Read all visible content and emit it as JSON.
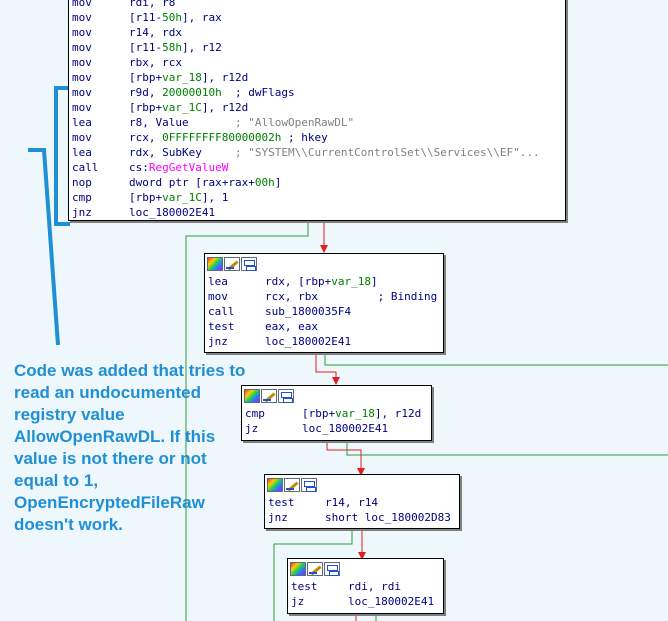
{
  "colors": {
    "flow_green": "#2a9d3a",
    "flow_red": "#e02020",
    "annotation": "#1f8fd6"
  },
  "icons": [
    "color-picker-icon",
    "rename-pencil-icon",
    "graph-overview-icon"
  ],
  "main_block": {
    "rows": [
      {
        "m": "mov",
        "ops": [
          {
            "t": "rdi, r8",
            "c": "blk"
          }
        ]
      },
      {
        "m": "mov",
        "ops": [
          {
            "t": "[r11-",
            "c": "blk"
          },
          {
            "t": "50h",
            "c": "num"
          },
          {
            "t": "], rax",
            "c": "blk"
          }
        ]
      },
      {
        "m": "mov",
        "ops": [
          {
            "t": "r14, rdx",
            "c": "blk"
          }
        ]
      },
      {
        "m": "mov",
        "ops": [
          {
            "t": "[r11-",
            "c": "blk"
          },
          {
            "t": "58h",
            "c": "num"
          },
          {
            "t": "], r12",
            "c": "blk"
          }
        ]
      },
      {
        "m": "mov",
        "ops": [
          {
            "t": "rbx, rcx",
            "c": "blk"
          }
        ]
      },
      {
        "m": "mov",
        "ops": [
          {
            "t": "[rbp+",
            "c": "blk"
          },
          {
            "t": "var_18",
            "c": "var"
          },
          {
            "t": "], r12d",
            "c": "blk"
          }
        ]
      },
      {
        "m": "mov",
        "ops": [
          {
            "t": "r9d, ",
            "c": "blk"
          },
          {
            "t": "20000010h",
            "c": "num"
          },
          {
            "t": "  ; dwFlags",
            "c": "blk"
          }
        ]
      },
      {
        "m": "mov",
        "ops": [
          {
            "t": "[rbp+",
            "c": "blk"
          },
          {
            "t": "var_1C",
            "c": "var"
          },
          {
            "t": "], r12d",
            "c": "blk"
          }
        ]
      },
      {
        "m": "lea",
        "ops": [
          {
            "t": "r8, Value       ",
            "c": "blk"
          },
          {
            "t": "; \"AllowOpenRawDL\"",
            "c": "com"
          }
        ]
      },
      {
        "m": "mov",
        "ops": [
          {
            "t": "rcx, ",
            "c": "blk"
          },
          {
            "t": "0FFFFFFFF80000002h",
            "c": "num"
          },
          {
            "t": " ; hkey",
            "c": "blk"
          }
        ]
      },
      {
        "m": "lea",
        "ops": [
          {
            "t": "rdx, SubKey     ",
            "c": "blk"
          },
          {
            "t": "; \"SYSTEM\\\\CurrentControlSet\\\\Services\\\\EF\"...",
            "c": "com"
          }
        ]
      },
      {
        "m": "call",
        "ops": [
          {
            "t": "cs:",
            "c": "blk"
          },
          {
            "t": "RegGetValueW",
            "c": "fn"
          }
        ]
      },
      {
        "m": "nop",
        "ops": [
          {
            "t": "dword ptr [rax+rax+",
            "c": "blk"
          },
          {
            "t": "00h",
            "c": "num"
          },
          {
            "t": "]",
            "c": "blk"
          }
        ]
      },
      {
        "m": "cmp",
        "ops": [
          {
            "t": "[rbp+",
            "c": "blk"
          },
          {
            "t": "var_1C",
            "c": "var"
          },
          {
            "t": "], 1",
            "c": "blk"
          }
        ]
      },
      {
        "m": "jnz",
        "ops": [
          {
            "t": "loc_180002E41",
            "c": "blk"
          }
        ]
      }
    ]
  },
  "blocks": [
    {
      "rows": [
        {
          "m": "lea",
          "ops": [
            {
              "t": "rdx, [rbp+",
              "c": "blk"
            },
            {
              "t": "var_18",
              "c": "var"
            },
            {
              "t": "]",
              "c": "blk"
            }
          ]
        },
        {
          "m": "mov",
          "ops": [
            {
              "t": "rcx, rbx         ; Binding",
              "c": "blk"
            }
          ]
        },
        {
          "m": "call",
          "ops": [
            {
              "t": "sub_1800035F4",
              "c": "blk"
            }
          ]
        },
        {
          "m": "test",
          "ops": [
            {
              "t": "eax, eax",
              "c": "blk"
            }
          ]
        },
        {
          "m": "jnz",
          "ops": [
            {
              "t": "loc_180002E41",
              "c": "blk"
            }
          ]
        }
      ]
    },
    {
      "rows": [
        {
          "m": "cmp",
          "ops": [
            {
              "t": "[rbp+",
              "c": "blk"
            },
            {
              "t": "var_18",
              "c": "var"
            },
            {
              "t": "], r12d",
              "c": "blk"
            }
          ]
        },
        {
          "m": "jz",
          "ops": [
            {
              "t": "loc_180002E41",
              "c": "blk"
            }
          ]
        }
      ]
    },
    {
      "rows": [
        {
          "m": "test",
          "ops": [
            {
              "t": "r14, r14",
              "c": "blk"
            }
          ]
        },
        {
          "m": "jnz",
          "ops": [
            {
              "t": "short loc_180002D83",
              "c": "blk"
            }
          ]
        }
      ]
    },
    {
      "rows": [
        {
          "m": "test",
          "ops": [
            {
              "t": "rdi, rdi",
              "c": "blk"
            }
          ]
        },
        {
          "m": "jz",
          "ops": [
            {
              "t": "loc_180002E41",
              "c": "blk"
            }
          ]
        }
      ]
    }
  ],
  "annotation": {
    "text": "Code was added that tries to read an undocumented registry value AllowOpenRawDL. If this value is not there or not equal to 1, OpenEncryptedFileRaw doesn't work."
  }
}
